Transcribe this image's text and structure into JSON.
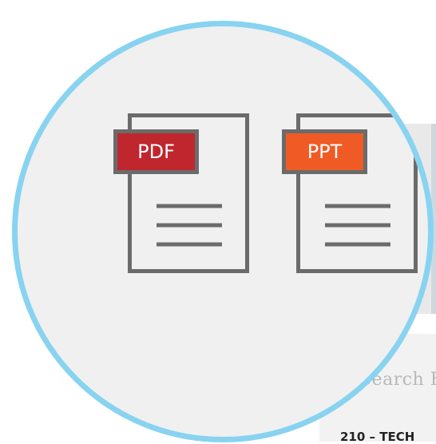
{
  "files": [
    {
      "label": "PDF",
      "icon": "pdf-file-icon",
      "color": "#c0262e"
    },
    {
      "label": "PPT",
      "icon": "ppt-file-icon",
      "color": "#f05b25"
    }
  ],
  "search": {
    "partial_text": "Search F"
  },
  "document": {
    "partial_title": "210 – TECH"
  },
  "colors": {
    "circle_border": "#88d3f0",
    "circle_fill": "#f0f0f0",
    "icon_stroke": "#6b6b6b"
  }
}
